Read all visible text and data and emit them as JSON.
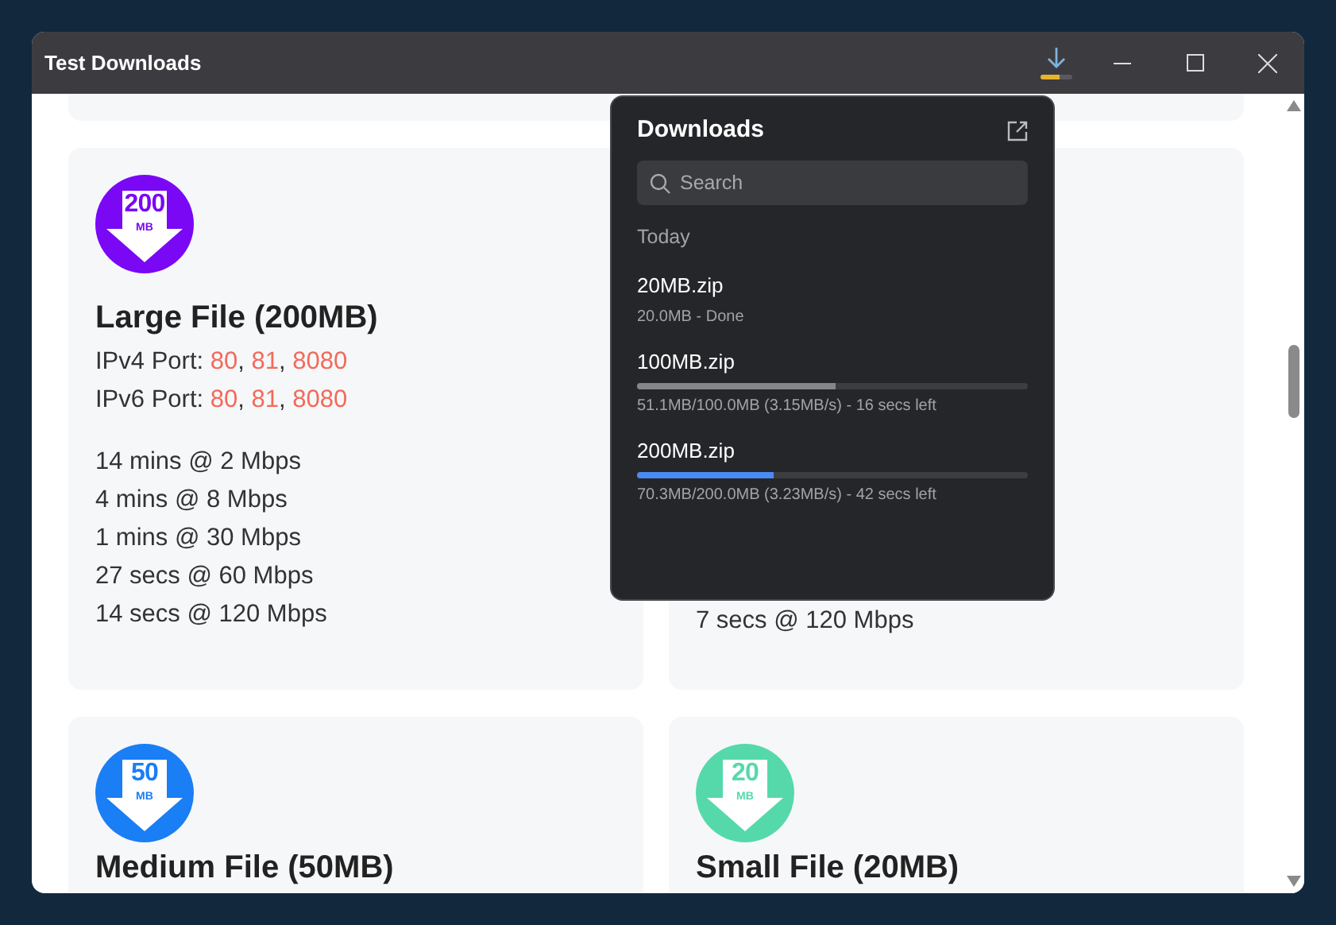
{
  "window": {
    "title": "Test Downloads",
    "download_progress": {
      "level": 0.6
    }
  },
  "cards": [
    {
      "kind": "partial"
    },
    {
      "kind": "partial"
    },
    {
      "kind": "full",
      "color": "#7a08f5",
      "badge_number": "200",
      "badge_unit": "MB",
      "title": "Large File (200MB)",
      "ports": [
        {
          "label": "IPv4 Port:",
          "values": [
            "80",
            "81",
            "8080"
          ],
          "separator": ","
        },
        {
          "label": "IPv6 Port:",
          "values": [
            "80",
            "81",
            "8080"
          ],
          "separator": ","
        }
      ],
      "speeds": [
        "14 mins @ 2 Mbps",
        "4 mins @ 8 Mbps",
        "1 mins @ 30 Mbps",
        "27 secs @ 60 Mbps",
        "14 secs @ 120 Mbps"
      ]
    },
    {
      "kind": "covered",
      "speeds": [
        "7 secs @ 120 Mbps"
      ]
    },
    {
      "kind": "cut",
      "color": "#1a7ef5",
      "badge_number": "50",
      "badge_unit": "MB",
      "title": "Medium File (50MB)"
    },
    {
      "kind": "cut",
      "color": "#55d9ab",
      "badge_number": "20",
      "badge_unit": "MB",
      "title": "Small File (20MB)"
    }
  ],
  "downloads_panel": {
    "title": "Downloads",
    "search": {
      "placeholder": "Search"
    },
    "section": "Today",
    "items": [
      {
        "kind": "done",
        "name": "20MB.zip",
        "status": "20.0MB - Done"
      },
      {
        "kind": "progress",
        "active": false,
        "name": "100MB.zip",
        "level": 0.51,
        "status": "51.1MB/100.0MB (3.15MB/s) - 16 secs left"
      },
      {
        "kind": "progress",
        "active": true,
        "name": "200MB.zip",
        "level": 0.35,
        "status": "70.3MB/200.0MB (3.23MB/s) - 42 secs left"
      }
    ]
  }
}
